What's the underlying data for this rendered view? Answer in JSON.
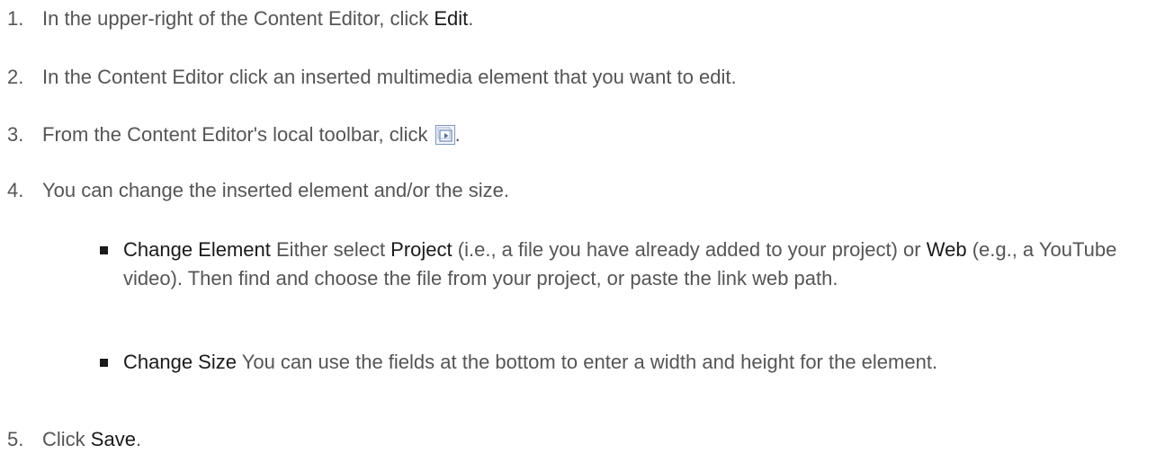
{
  "steps": [
    {
      "num": "1.",
      "pre": "In the upper-right of the Content Editor, click ",
      "strong": "Edit",
      "post": "."
    },
    {
      "num": "2.",
      "text": "In the Content Editor click an inserted multimedia element that you want to edit."
    },
    {
      "num": "3.",
      "pre": "From the Content Editor's local toolbar, click ",
      "icon": "multimedia-toolbar-icon",
      "post": "."
    },
    {
      "num": "4.",
      "text": "You can change the inserted element and/or the size.",
      "bullets": [
        {
          "label": "Change Element",
          "t1": " Either select ",
          "b1": "Project",
          "t2": " (i.e., a file you have already added to your project) or ",
          "b2": "Web",
          "t3": " (e.g., a YouTube video). Then find and choose the file from your project, or paste the link web path."
        },
        {
          "label": "Change Size",
          "t1": " You can use the fields at the bottom to enter a width and height for the element."
        }
      ]
    },
    {
      "num": "5.",
      "pre": "Click ",
      "strong": "Save",
      "post": "."
    }
  ],
  "colors": {
    "body_text": "#555555",
    "emphasis_text": "#1a1a1a",
    "icon_blue": "#6f8fbf"
  }
}
